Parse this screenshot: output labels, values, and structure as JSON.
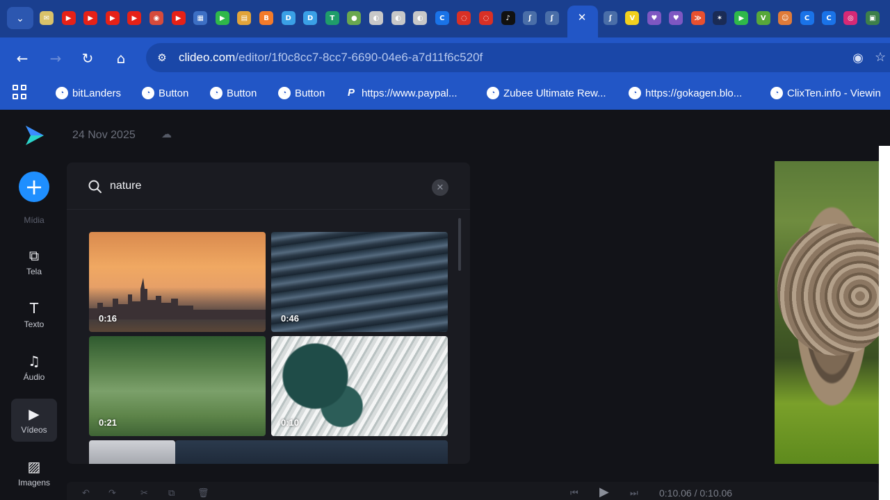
{
  "browser": {
    "tab_icons": [
      {
        "name": "mail-icon",
        "color": "#d9c26a",
        "glyph": "✉"
      },
      {
        "name": "youtube-icon",
        "color": "#e62117",
        "glyph": "▶"
      },
      {
        "name": "youtube-icon",
        "color": "#e62117",
        "glyph": "▶"
      },
      {
        "name": "youtube-icon",
        "color": "#e62117",
        "glyph": "▶"
      },
      {
        "name": "youtube-icon",
        "color": "#e62117",
        "glyph": "▶"
      },
      {
        "name": "chrome-icon",
        "color": "#d64b3c",
        "glyph": "◉"
      },
      {
        "name": "youtube-icon",
        "color": "#e62117",
        "glyph": "▶"
      },
      {
        "name": "site-icon",
        "color": "#3d6fc4",
        "glyph": "▦"
      },
      {
        "name": "play-icon",
        "color": "#2fb84a",
        "glyph": "▶"
      },
      {
        "name": "folder-icon",
        "color": "#e2a43a",
        "glyph": "▤"
      },
      {
        "name": "blogger-icon",
        "color": "#f47b2a",
        "glyph": "B"
      },
      {
        "name": "site-icon",
        "color": "#3aa0e6",
        "glyph": "D"
      },
      {
        "name": "site-icon",
        "color": "#3aa0e6",
        "glyph": "D"
      },
      {
        "name": "site-icon",
        "color": "#1f9d6a",
        "glyph": "T"
      },
      {
        "name": "site-icon",
        "color": "#6aa84f",
        "glyph": "●"
      },
      {
        "name": "site-icon",
        "color": "#c8c8c8",
        "glyph": "◐"
      },
      {
        "name": "site-icon",
        "color": "#c8c8c8",
        "glyph": "◐"
      },
      {
        "name": "site-icon",
        "color": "#c8c8c8",
        "glyph": "◐"
      },
      {
        "name": "site-icon",
        "color": "#1a73e8",
        "glyph": "C"
      },
      {
        "name": "site-icon",
        "color": "#d93025",
        "glyph": "◌"
      },
      {
        "name": "site-icon",
        "color": "#d93025",
        "glyph": "◌"
      },
      {
        "name": "tiktok-icon",
        "color": "#111111",
        "glyph": "♪"
      },
      {
        "name": "site-icon",
        "color": "#4a6ea8",
        "glyph": "ʃ"
      },
      {
        "name": "site-icon",
        "color": "#4a6ea8",
        "glyph": "ʃ"
      }
    ],
    "tab_icons_right": [
      {
        "name": "site-icon",
        "color": "#4a6ea8",
        "glyph": "ʃ"
      },
      {
        "name": "site-icon",
        "color": "#f2d01e",
        "glyph": "V"
      },
      {
        "name": "site-icon",
        "color": "#7e57c2",
        "glyph": "♥"
      },
      {
        "name": "site-icon",
        "color": "#7e57c2",
        "glyph": "♥"
      },
      {
        "name": "site-icon",
        "color": "#e8502f",
        "glyph": "≫"
      },
      {
        "name": "site-icon",
        "color": "#1a2b55",
        "glyph": "✶"
      },
      {
        "name": "play-icon",
        "color": "#2fb84a",
        "glyph": "▶"
      },
      {
        "name": "site-icon",
        "color": "#57a83a",
        "glyph": "V"
      },
      {
        "name": "site-icon",
        "color": "#e07b39",
        "glyph": "☺"
      },
      {
        "name": "site-icon",
        "color": "#1a73e8",
        "glyph": "C"
      },
      {
        "name": "site-icon",
        "color": "#1a73e8",
        "glyph": "C"
      },
      {
        "name": "instagram-icon",
        "color": "#d62976",
        "glyph": "◎"
      },
      {
        "name": "site-icon",
        "color": "#3d7f4a",
        "glyph": "▣"
      }
    ],
    "url_host": "clideo.com",
    "url_path": "/editor/1f0c8cc7-8cc7-6690-04e6-a7d11f6c520f",
    "bookmarks": [
      {
        "label": "bitLanders",
        "icon": "globe"
      },
      {
        "label": "Button",
        "icon": "globe"
      },
      {
        "label": "Button",
        "icon": "globe"
      },
      {
        "label": "Button",
        "icon": "globe"
      },
      {
        "label": "https://www.paypal...",
        "icon": "paypal"
      },
      {
        "label": "Zubee Ultimate Rew...",
        "icon": "globe"
      },
      {
        "label": "https://gokagen.blo...",
        "icon": "globe"
      },
      {
        "label": "ClixTen.info - Viewin",
        "icon": "globe"
      }
    ]
  },
  "editor": {
    "date": "24 Nov 2025",
    "add_label": "Mídia",
    "sidebar": [
      {
        "name": "sidebar-item-tela",
        "label": "Tela",
        "glyph": "⧉",
        "icon": "canvas-icon"
      },
      {
        "name": "sidebar-item-texto",
        "label": "Texto",
        "glyph": "T",
        "icon": "text-icon"
      },
      {
        "name": "sidebar-item-audio",
        "label": "Áudio",
        "glyph": "♫",
        "icon": "music-icon"
      },
      {
        "name": "sidebar-item-videos",
        "label": "Vídeos",
        "glyph": "▶",
        "icon": "video-icon",
        "active": true
      },
      {
        "name": "sidebar-item-imagens",
        "label": "Imagens",
        "glyph": "▨",
        "icon": "image-icon"
      }
    ],
    "search": {
      "value": "nature"
    },
    "videos": [
      {
        "duration": "0:16",
        "subject": "city skyline at sunset"
      },
      {
        "duration": "0:46",
        "subject": "ocean waves"
      },
      {
        "duration": "0:21",
        "subject": "green grass field"
      },
      {
        "duration": "0:10",
        "subject": "foamy water aerial"
      }
    ],
    "timecode": "0:10.06 / 0:10.06",
    "colors": {
      "accent": "#1f8fff",
      "background": "#121318",
      "panel": "#1a1b21"
    }
  }
}
